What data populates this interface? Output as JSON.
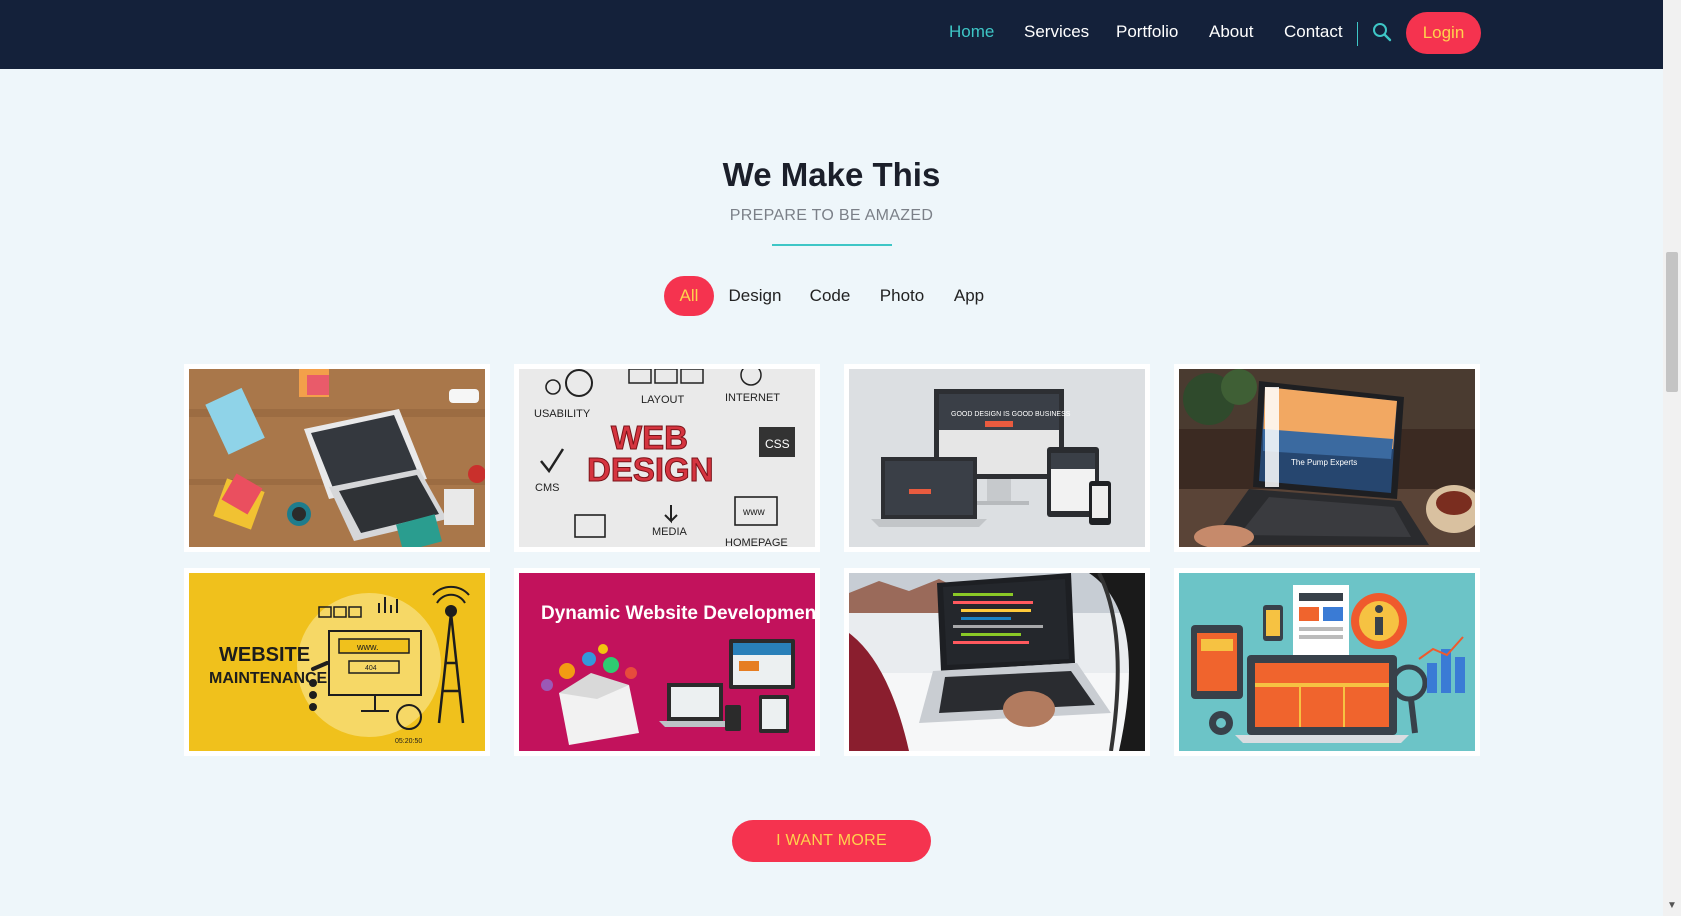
{
  "nav": {
    "items": [
      "Home",
      "Services",
      "Portfolio",
      "About",
      "Contact"
    ],
    "login_label": "Login"
  },
  "section": {
    "title": "We Make This",
    "subtitle": "PREPARE TO BE AMAZED"
  },
  "filters": [
    "All",
    "Design",
    "Code",
    "Photo",
    "App"
  ],
  "portfolio": {
    "card2": {
      "words": [
        "USABILITY",
        "LAYOUT",
        "INTERNET",
        "WEB",
        "DESIGN",
        "CSS",
        "CMS",
        "MEDIA",
        "www",
        "HOMEPAGE"
      ]
    },
    "card3": {
      "headline": "GOOD DESIGN IS GOOD BUSINESS"
    },
    "card4": {
      "headline": "The Pump Experts"
    },
    "card5": {
      "line1": "WEBSITE",
      "line2": "MAINTENANCE",
      "tag": "www.",
      "code": "404",
      "clock": "05:20:50"
    },
    "card6": {
      "headline": "Dynamic Website Development"
    }
  },
  "cta": {
    "label": "I WANT MORE"
  },
  "colors": {
    "nav_bg": "#14213a",
    "accent_teal": "#3ec6c6",
    "accent_red": "#f5334f",
    "accent_yellow": "#ffd24d",
    "page_bg": "#eef6fa"
  },
  "icons": [
    "search-icon"
  ]
}
